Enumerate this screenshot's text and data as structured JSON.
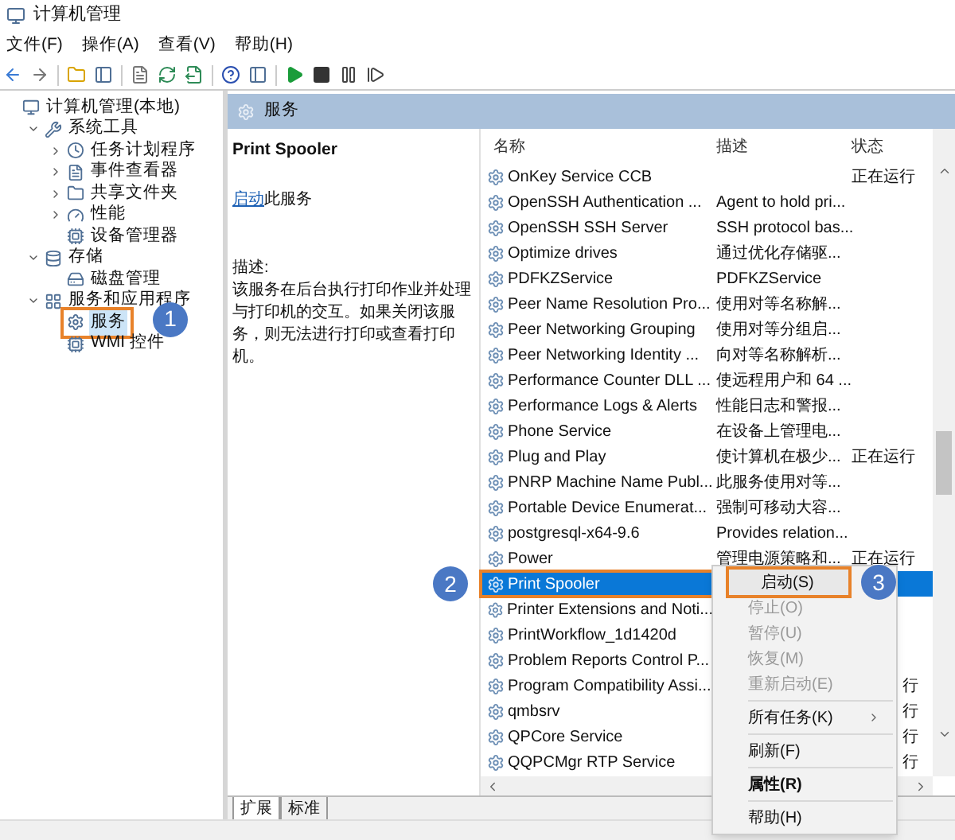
{
  "window": {
    "title": "计算机管理"
  },
  "menu_bar": [
    "文件(F)",
    "操作(A)",
    "查看(V)",
    "帮助(H)"
  ],
  "toolbar": [
    {
      "kind": "back"
    },
    {
      "kind": "forward"
    },
    {
      "kind": "sep"
    },
    {
      "kind": "folder"
    },
    {
      "kind": "pane"
    },
    {
      "kind": "sep"
    },
    {
      "kind": "doc"
    },
    {
      "kind": "refresh"
    },
    {
      "kind": "export"
    },
    {
      "kind": "sep"
    },
    {
      "kind": "help"
    },
    {
      "kind": "pane"
    },
    {
      "kind": "sep"
    },
    {
      "kind": "play"
    },
    {
      "kind": "stop"
    },
    {
      "kind": "pause"
    },
    {
      "kind": "resume"
    }
  ],
  "tree": [
    {
      "label": "计算机管理(本地)",
      "selected": false,
      "children": [
        {
          "label": "系统工具",
          "selected": false,
          "expanded": true,
          "children": [
            {
              "label": "任务计划程序",
              "selected": false,
              "expanded": false
            },
            {
              "label": "事件查看器",
              "selected": false,
              "expanded": false
            },
            {
              "label": "共享文件夹",
              "selected": false,
              "expanded": false
            },
            {
              "label": "性能",
              "selected": false,
              "expanded": false
            },
            {
              "label": "设备管理器",
              "selected": false
            }
          ]
        },
        {
          "label": "存储",
          "selected": false,
          "expanded": true,
          "children": [
            {
              "label": "磁盘管理",
              "selected": false
            }
          ]
        },
        {
          "label": "服务和应用程序",
          "selected": false,
          "expanded": true,
          "children": [
            {
              "label": "服务",
              "selected": true,
              "callout": "1"
            },
            {
              "label": "WMI 控件",
              "selected": false
            }
          ]
        }
      ]
    }
  ],
  "panel": {
    "title": "服务"
  },
  "details": {
    "service_name": "Print Spooler",
    "action_link": "启动",
    "action_text": "此服务",
    "description_label": "描述:",
    "description": "该服务在后台执行打印作业并处理与打印机的交互。如果关闭该服务，则无法进行打印或查看打印机。"
  },
  "table": {
    "columns": [
      "名称",
      "描述",
      "状态"
    ],
    "rows": [
      {
        "name": "OnKey Service CCB",
        "status": "正在运行",
        "selected": false
      },
      {
        "name": "OpenSSH Authentication ...",
        "description": "Agent to hold pri...",
        "selected": false
      },
      {
        "name": "OpenSSH SSH Server",
        "description": "SSH protocol bas...",
        "selected": false
      },
      {
        "name": "Optimize drives",
        "description": "通过优化存储驱...",
        "selected": false
      },
      {
        "name": "PDFKZService",
        "description": "PDFKZService",
        "selected": false
      },
      {
        "name": "Peer Name Resolution Pro...",
        "description": "使用对等名称解...",
        "selected": false
      },
      {
        "name": "Peer Networking Grouping",
        "description": "使用对等分组启...",
        "selected": false
      },
      {
        "name": "Peer Networking Identity ...",
        "description": "向对等名称解析...",
        "selected": false
      },
      {
        "name": "Performance Counter DLL ...",
        "description": "使远程用户和 64 ...",
        "selected": false
      },
      {
        "name": "Performance Logs & Alerts",
        "description": "性能日志和警报...",
        "selected": false
      },
      {
        "name": "Phone Service",
        "description": "在设备上管理电...",
        "selected": false
      },
      {
        "name": "Plug and Play",
        "description": "使计算机在极少...",
        "status": "正在运行",
        "selected": false
      },
      {
        "name": "PNRP Machine Name Publ...",
        "description": "此服务使用对等...",
        "selected": false
      },
      {
        "name": "Portable Device Enumerat...",
        "description": "强制可移动大容...",
        "selected": false
      },
      {
        "name": "postgresql-x64-9.6",
        "description": "Provides relation...",
        "selected": false
      },
      {
        "name": "Power",
        "description": "管理电源策略和...",
        "status": "正在运行",
        "selected": false
      },
      {
        "name": "Print Spooler",
        "selected": true,
        "callout": "2"
      },
      {
        "name": "Printer Extensions and Noti...",
        "selected": false
      },
      {
        "name": "PrintWorkflow_1d1420d",
        "selected": false
      },
      {
        "name": "Problem Reports Control P...",
        "selected": false
      },
      {
        "name": "Program Compatibility Assi...",
        "status": "行",
        "selected": false
      },
      {
        "name": "qmbsrv",
        "status": "行",
        "selected": false
      },
      {
        "name": "QPCore Service",
        "status": "行",
        "selected": false
      },
      {
        "name": "QQPCMgr RTP Service",
        "status": "行",
        "selected": false
      }
    ]
  },
  "tabs": [
    {
      "label": "扩展",
      "selected": true
    },
    {
      "label": "标准",
      "selected": false
    }
  ],
  "context_menu": [
    {
      "kind": "item",
      "label": "启动(S)",
      "disabled": false,
      "callout": "3"
    },
    {
      "kind": "item",
      "label": "停止(O)",
      "disabled": true
    },
    {
      "kind": "item",
      "label": "暂停(U)",
      "disabled": true
    },
    {
      "kind": "item",
      "label": "恢复(M)",
      "disabled": true
    },
    {
      "kind": "item",
      "label": "重新启动(E)",
      "disabled": true
    },
    {
      "kind": "separator"
    },
    {
      "kind": "submenu",
      "label": "所有任务(K)",
      "disabled": false
    },
    {
      "kind": "separator"
    },
    {
      "kind": "item",
      "label": "刷新(F)",
      "disabled": false
    },
    {
      "kind": "separator"
    },
    {
      "kind": "default",
      "label": "属性(R)",
      "disabled": false
    },
    {
      "kind": "separator"
    },
    {
      "kind": "item",
      "label": "帮助(H)",
      "disabled": false
    }
  ]
}
